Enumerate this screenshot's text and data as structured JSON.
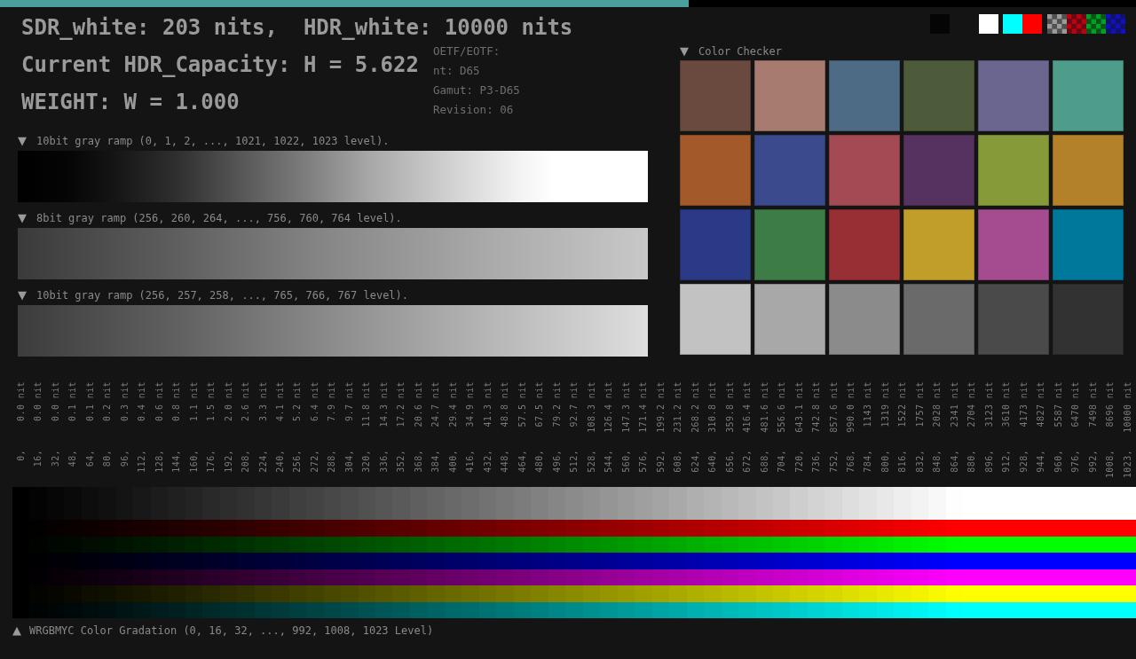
{
  "progress": {
    "level": 0.606
  },
  "header": {
    "lines": [
      "SDR_white: 203 nits,  HDR_white: 10000 nits",
      "Current HDR_Capacity: H = 5.622",
      "WEIGHT: W = 1.000"
    ],
    "info": [
      "OETF/EOTF:",
      "nt: D65",
      "Gamut: P3-D65",
      "Revision: 06"
    ]
  },
  "swatches": [
    {
      "kind": "solid",
      "color": "#050505"
    },
    {
      "kind": "solid",
      "color": "#ffffff"
    },
    {
      "kind": "solid",
      "color": "#00ffff"
    },
    {
      "kind": "solid",
      "color": "#ff0000"
    },
    {
      "kind": "checker",
      "color": "#9a9a9a"
    },
    {
      "kind": "checker",
      "color": "#c00010"
    },
    {
      "kind": "checker",
      "color": "#00a020"
    },
    {
      "kind": "checker",
      "color": "#1010c0"
    }
  ],
  "gray_ramps": [
    {
      "marker": "▼",
      "label": "10bit gray ramp (0, 1, 2, ..., 1021, 1022, 1023 level).",
      "kind": "full"
    },
    {
      "marker": "▼",
      "label": "8bit gray ramp (256, 260, 264, ..., 756, 760, 764 level).",
      "kind": "coarse"
    },
    {
      "marker": "▼",
      "label": "10bit gray ramp (256, 257, 258, ..., 765, 766, 767 level).",
      "kind": "fine"
    }
  ],
  "color_checker": {
    "marker": "▼",
    "label": "Color Checker",
    "patches": [
      {
        "color": "#6a4a3f"
      },
      {
        "color": "#a77b70"
      },
      {
        "color": "#4e6b86"
      },
      {
        "color": "#4e5b3a"
      },
      {
        "color": "#6a6690"
      },
      {
        "color": "#4e9c8a"
      },
      {
        "color": "#a3592a"
      },
      {
        "color": "#3b4a8c"
      },
      {
        "color": "#a44a55"
      },
      {
        "color": "#55325f"
      },
      {
        "color": "#869a3a"
      },
      {
        "color": "#b3812a"
      },
      {
        "color": "#2b3a87"
      },
      {
        "color": "#3d7b47"
      },
      {
        "color": "#972f35"
      },
      {
        "color": "#c19e2a"
      },
      {
        "color": "#a44c8f"
      },
      {
        "color": "#00789b"
      },
      {
        "color": "#c2c2c2"
      },
      {
        "color": "#a8a8a8"
      },
      {
        "color": "#8b8b8b"
      },
      {
        "color": "#6a6a6a"
      },
      {
        "color": "#4a4a4a"
      },
      {
        "color": "#323232"
      }
    ]
  },
  "luminance_scale": [
    {
      "nit": "0.0 nit",
      "code": "0,"
    },
    {
      "nit": "0.0 nit",
      "code": "16,"
    },
    {
      "nit": "0.0 nit",
      "code": "32,"
    },
    {
      "nit": "0.1 nit",
      "code": "48,"
    },
    {
      "nit": "0.1 nit",
      "code": "64,"
    },
    {
      "nit": "0.2 nit",
      "code": "80,"
    },
    {
      "nit": "0.3 nit",
      "code": "96,"
    },
    {
      "nit": "0.4 nit",
      "code": "112,"
    },
    {
      "nit": "0.6 nit",
      "code": "128,"
    },
    {
      "nit": "0.8 nit",
      "code": "144,"
    },
    {
      "nit": "1.1 nit",
      "code": "160,"
    },
    {
      "nit": "1.5 nit",
      "code": "176,"
    },
    {
      "nit": "2.0 nit",
      "code": "192,"
    },
    {
      "nit": "2.6 nit",
      "code": "208,"
    },
    {
      "nit": "3.3 nit",
      "code": "224,"
    },
    {
      "nit": "4.1 nit",
      "code": "240,"
    },
    {
      "nit": "5.2 nit",
      "code": "256,"
    },
    {
      "nit": "6.4 nit",
      "code": "272,"
    },
    {
      "nit": "7.9 nit",
      "code": "288,"
    },
    {
      "nit": "9.7 nit",
      "code": "304,"
    },
    {
      "nit": "11.8 nit",
      "code": "320,"
    },
    {
      "nit": "14.3 nit",
      "code": "336,"
    },
    {
      "nit": "17.2 nit",
      "code": "352,"
    },
    {
      "nit": "20.6 nit",
      "code": "368,"
    },
    {
      "nit": "24.7 nit",
      "code": "384,"
    },
    {
      "nit": "29.4 nit",
      "code": "400,"
    },
    {
      "nit": "34.9 nit",
      "code": "416,"
    },
    {
      "nit": "41.3 nit",
      "code": "432,"
    },
    {
      "nit": "48.8 nit",
      "code": "448,"
    },
    {
      "nit": "57.5 nit",
      "code": "464,"
    },
    {
      "nit": "67.5 nit",
      "code": "480,"
    },
    {
      "nit": "79.2 nit",
      "code": "496,"
    },
    {
      "nit": "92.7 nit",
      "code": "512,"
    },
    {
      "nit": "108.3 nit",
      "code": "528,"
    },
    {
      "nit": "126.4 nit",
      "code": "544,"
    },
    {
      "nit": "147.3 nit",
      "code": "560,"
    },
    {
      "nit": "171.4 nit",
      "code": "576,"
    },
    {
      "nit": "199.2 nit",
      "code": "592,"
    },
    {
      "nit": "231.2 nit",
      "code": "608,"
    },
    {
      "nit": "268.2 nit",
      "code": "624,"
    },
    {
      "nit": "310.8 nit",
      "code": "640,"
    },
    {
      "nit": "359.8 nit",
      "code": "656,"
    },
    {
      "nit": "416.4 nit",
      "code": "672,"
    },
    {
      "nit": "481.6 nit",
      "code": "688,"
    },
    {
      "nit": "556.6 nit",
      "code": "704,"
    },
    {
      "nit": "643.1 nit",
      "code": "720,"
    },
    {
      "nit": "742.8 nit",
      "code": "736,"
    },
    {
      "nit": "857.6 nit",
      "code": "752,"
    },
    {
      "nit": "990.0 nit",
      "code": "768,"
    },
    {
      "nit": "1143 nit",
      "code": "784,"
    },
    {
      "nit": "1319 nit",
      "code": "800,"
    },
    {
      "nit": "1522 nit",
      "code": "816,"
    },
    {
      "nit": "1757 nit",
      "code": "832,"
    },
    {
      "nit": "2028 nit",
      "code": "848,"
    },
    {
      "nit": "2341 nit",
      "code": "864,"
    },
    {
      "nit": "2704 nit",
      "code": "880,"
    },
    {
      "nit": "3123 nit",
      "code": "896,"
    },
    {
      "nit": "3610 nit",
      "code": "912,"
    },
    {
      "nit": "4173 nit",
      "code": "928,"
    },
    {
      "nit": "4827 nit",
      "code": "944,"
    },
    {
      "nit": "5587 nit",
      "code": "960,"
    },
    {
      "nit": "6470 nit",
      "code": "976,"
    },
    {
      "nit": "7498 nit",
      "code": "992,"
    },
    {
      "nit": "8696 nit",
      "code": "1008,"
    },
    {
      "nit": "10000 nit",
      "code": "1023,"
    }
  ],
  "gradation": {
    "bands": [
      {
        "color": "#ffffff"
      },
      {
        "color": "#ff0000"
      },
      {
        "color": "#00ff00"
      },
      {
        "color": "#0000ff"
      },
      {
        "color": "#ff00ff"
      },
      {
        "color": "#ffff00"
      },
      {
        "color": "#00ffff"
      }
    ],
    "marker": "▲",
    "label": "WRGBMYC Color Gradation (0, 16, 32, ..., 992, 1008, 1023 Level)"
  }
}
